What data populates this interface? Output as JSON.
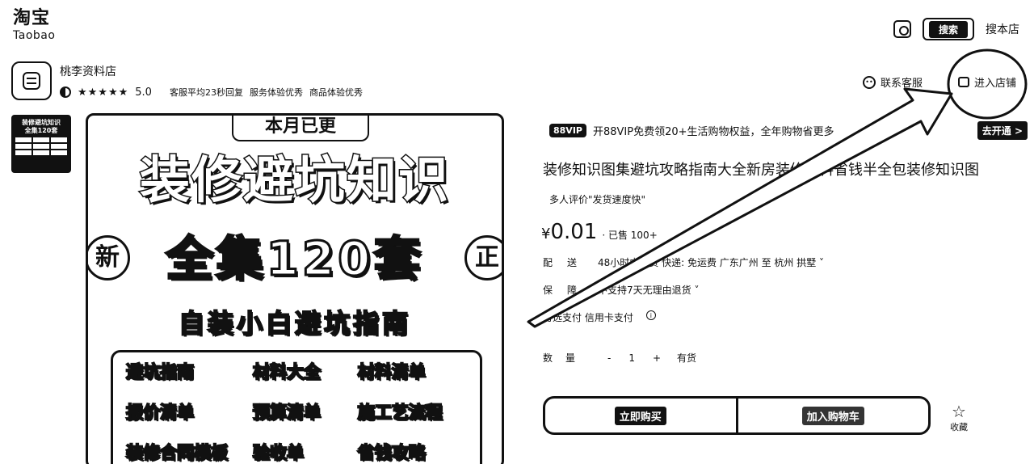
{
  "header": {
    "logo_cn": "淘宝",
    "logo_en": "Taobao",
    "search_label": "搜索",
    "store_search_label": "搜本店",
    "camera_icon": "camera-icon"
  },
  "shop": {
    "name": "桃李资料店",
    "stars": "★★★★★",
    "rating": "5.0",
    "reply_time": "客服平均23秒回复",
    "service": "服务体验优秀",
    "goods": "商品体验优秀",
    "contact_label": "联系客服",
    "enter_label": "进入店铺"
  },
  "thumbnail": {
    "line1": "装修避坑知识",
    "line2": "全集120套"
  },
  "main_image": {
    "banner": "本月已更",
    "title_line1": "装修避坑知识",
    "badge_left": "新",
    "title_line2": "全集120套",
    "badge_right": "正",
    "subtitle": "自装小白避坑指南",
    "items": [
      "避坑指南",
      "材料大全",
      "材料清单",
      "报价清单",
      "预算清单",
      "施工艺流程",
      "装修合同模板",
      "验收单",
      "省钱攻略"
    ]
  },
  "vip": {
    "badge": "88VIP",
    "text": "开88VIP免费领20+生活购物权益，全年购物省更多",
    "button": "去开通 >"
  },
  "product": {
    "title": "装修知识图集避坑攻略指南大全新房装修资料省钱半全包装修知识图",
    "review_tag": "多人评价\"发货速度快\"",
    "price_symbol": "¥",
    "price": "0.01",
    "sold": "· 已售 100+",
    "delivery_label": "配送",
    "delivery_text": "48小时内发货  快递: 免运费  广东广州 至 杭州 拱墅 ˅",
    "guarantee_label": "保障",
    "guarantee_text": "不支持7天无理由退货 ˅",
    "payment_text": "可选支付   信用卡支付",
    "qty_label": "数量",
    "qty_minus": "-",
    "qty_value": "1",
    "qty_plus": "+",
    "stock": "有货",
    "buy_label": "立即购买",
    "cart_label": "加入购物车",
    "fav_label": "收藏"
  }
}
